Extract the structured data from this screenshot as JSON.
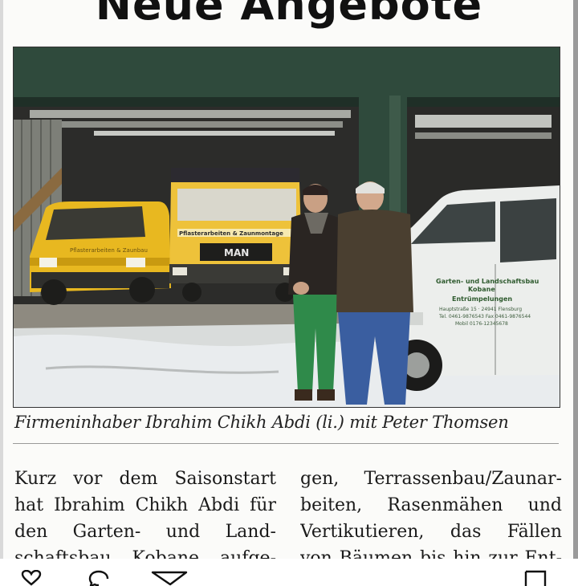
{
  "article": {
    "headline": "Neue Angebote",
    "photo": {
      "van_sign": "Pflasterarbeiten & Zaunbau",
      "truck_sign": "Pflasterarbeiten & Zaunmontage",
      "truck_brand": "MAN",
      "car_sign": {
        "line1": "Garten- und Landschaftsbau",
        "line2": "Kobane",
        "line3": "Entrümpelungen",
        "line4": "Hauptstraße 15 · 24941 Flensburg",
        "line5": "Tel. 0461-9876543 Fax 0461-9876544",
        "line6": "Mobil 0176-12345678"
      }
    },
    "caption": "Firmeninhaber Ibrahim Chikh Abdi (li.) mit Peter Thomsen",
    "columns": {
      "left": [
        "Kurz vor dem Saisonstart",
        "hat Ibrahim Chikh Abdi für",
        "den Garten- und Land-",
        "schaftsbau Kobane aufge-"
      ],
      "right": [
        "gen, Terrassenbau/Zaunar-",
        "beiten, Rasenmähen und",
        "Vertikutieren, das Fällen",
        "von Bäumen bis hin zur Ent-"
      ]
    }
  },
  "toolbar": {
    "icons": [
      "heart-icon",
      "comment-icon",
      "share-icon",
      "bookmark-icon"
    ]
  },
  "colors": {
    "hall_green": "#2f4a3c",
    "van_yellow": "#e8b820",
    "truck_yellow": "#eec23a",
    "car_white": "#eceeec",
    "ink": "#111111"
  }
}
